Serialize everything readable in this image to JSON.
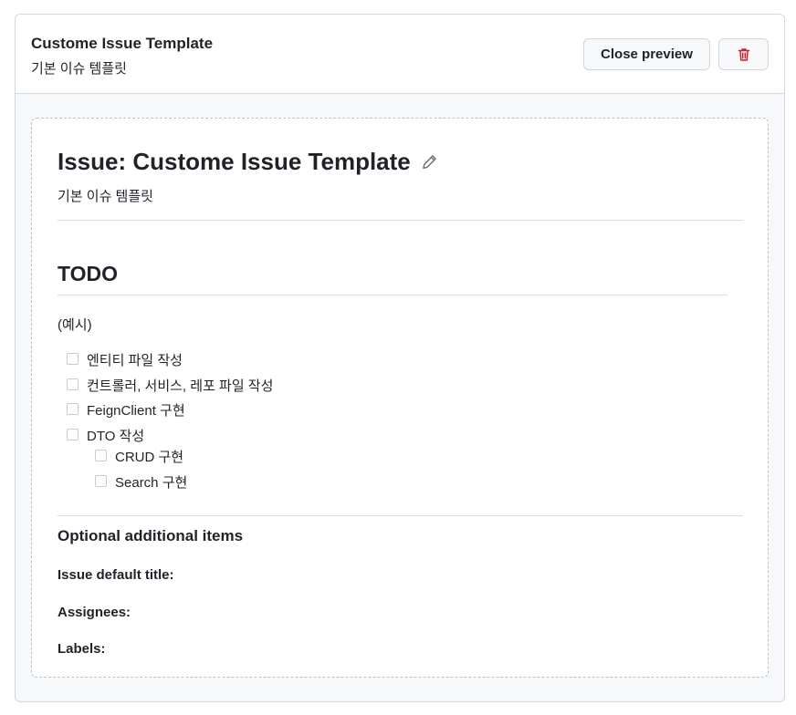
{
  "header": {
    "title": "Custome Issue Template",
    "subtitle": "기본 이슈 템플릿",
    "close_preview_label": "Close preview",
    "delete_icon": "trash-icon"
  },
  "preview": {
    "issue_title": "Issue: Custome Issue Template",
    "edit_icon": "pencil-icon",
    "description": "기본 이슈 템플릿",
    "todo_heading": "TODO",
    "example_text": "(예시)",
    "tasks": [
      {
        "label": "엔티티 파일 작성",
        "checked": false
      },
      {
        "label": "컨트롤러, 서비스, 레포 파일 작성",
        "checked": false
      },
      {
        "label": "FeignClient 구현",
        "checked": false
      },
      {
        "label": "DTO 작성",
        "checked": false,
        "subtasks": [
          {
            "label": "CRUD 구현",
            "checked": false
          },
          {
            "label": "Search 구현",
            "checked": false
          }
        ]
      }
    ],
    "optional_heading": "Optional additional items",
    "fields": {
      "default_title_label": "Issue default title:",
      "assignees_label": "Assignees:",
      "labels_label": "Labels:"
    }
  },
  "colors": {
    "danger": "#cf222e",
    "border": "#d0d7de",
    "text": "#1f2328",
    "muted_icon": "#656d76"
  }
}
